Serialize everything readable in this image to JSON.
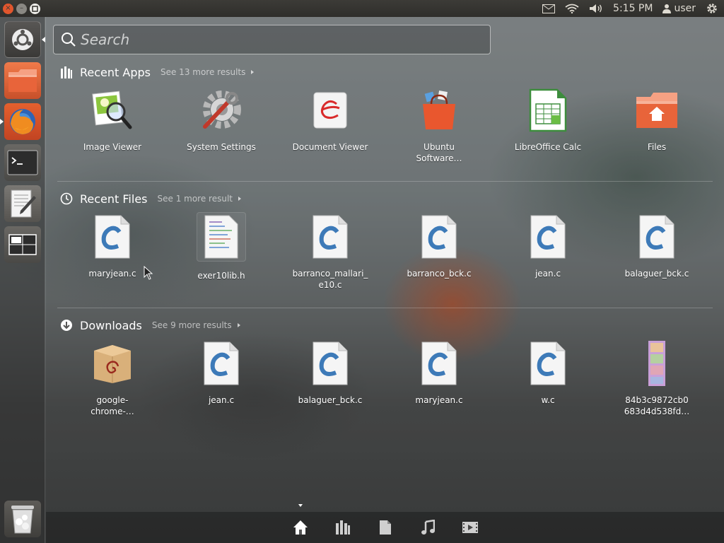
{
  "top_panel": {
    "time": "5:15 PM",
    "user": "user"
  },
  "search": {
    "placeholder": "Search"
  },
  "sections": {
    "apps": {
      "title": "Recent Apps",
      "more": "See 13 more results",
      "items": [
        {
          "label": "Image Viewer",
          "icon": "image-viewer-icon"
        },
        {
          "label": "System Settings",
          "icon": "system-settings-icon"
        },
        {
          "label": "Document Viewer",
          "icon": "document-viewer-icon"
        },
        {
          "label": "Ubuntu Software…",
          "icon": "ubuntu-software-icon"
        },
        {
          "label": "LibreOffice Calc",
          "icon": "libreoffice-calc-icon"
        },
        {
          "label": "Files",
          "icon": "files-folder-icon"
        }
      ]
    },
    "files": {
      "title": "Recent Files",
      "more": "See 1 more result",
      "items": [
        {
          "label": "maryjean.c",
          "icon": "c-source-file-icon"
        },
        {
          "label": "exer10lib.h",
          "icon": "header-file-icon"
        },
        {
          "label": "barranco_mallari_e10.c",
          "icon": "c-source-file-icon"
        },
        {
          "label": "barranco_bck.c",
          "icon": "c-source-file-icon"
        },
        {
          "label": "jean.c",
          "icon": "c-source-file-icon"
        },
        {
          "label": "balaguer_bck.c",
          "icon": "c-source-file-icon"
        }
      ]
    },
    "downloads": {
      "title": "Downloads",
      "more": "See 9 more results",
      "items": [
        {
          "label": "google-chrome-…",
          "icon": "debian-package-icon"
        },
        {
          "label": "jean.c",
          "icon": "c-source-file-icon"
        },
        {
          "label": "balaguer_bck.c",
          "icon": "c-source-file-icon"
        },
        {
          "label": "maryjean.c",
          "icon": "c-source-file-icon"
        },
        {
          "label": "w.c",
          "icon": "c-source-file-icon"
        },
        {
          "label": "84b3c9872cb0683d4d538fd…",
          "icon": "image-strip-icon"
        }
      ]
    }
  },
  "launcher": [
    "dash-home-icon",
    "files-folder-icon",
    "firefox-icon",
    "terminal-icon",
    "text-editor-icon",
    "workspace-switcher-icon",
    "trash-icon"
  ],
  "lenses": [
    "home-lens-icon",
    "applications-lens-icon",
    "files-lens-icon",
    "music-lens-icon",
    "video-lens-icon"
  ],
  "colors": {
    "accent": "#e2562d",
    "panel": "#3c3b37"
  }
}
